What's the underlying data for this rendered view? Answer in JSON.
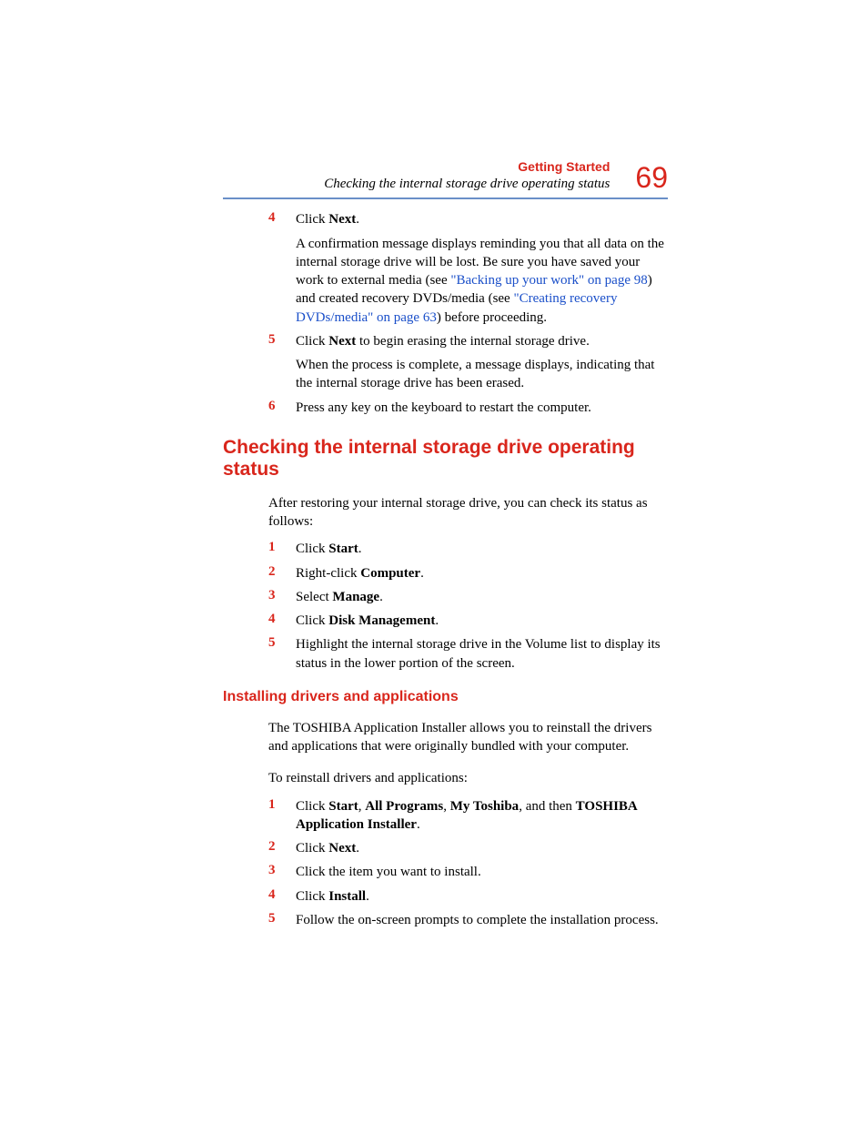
{
  "header": {
    "section_label": "Getting Started",
    "subtitle": "Checking the internal storage drive operating status",
    "page_number": "69"
  },
  "top_steps": [
    {
      "num": "4",
      "line1_pre": "Click ",
      "line1_bold": "Next",
      "line1_post": ".",
      "para_seg1": "A confirmation message displays reminding you that all data on the internal storage drive will be lost. Be sure you have saved your work to external media (see ",
      "link1": "\"Backing up your work\" on page 98",
      "para_seg2": ") and created recovery DVDs/media (see ",
      "link2": "\"Creating recovery DVDs/media\" on page 63",
      "para_seg3": ") before proceeding."
    },
    {
      "num": "5",
      "line1_pre": "Click ",
      "line1_bold": "Next",
      "line1_post": " to begin erasing the internal storage drive.",
      "para_seg1": "When the process is complete, a message displays, indicating that the internal storage drive has been erased."
    },
    {
      "num": "6",
      "line1_pre": "Press any key on the keyboard to restart the computer."
    }
  ],
  "heading1": "Checking the internal storage drive operating status",
  "para1": "After restoring your internal storage drive, you can check its status as follows:",
  "check_steps": [
    {
      "num": "1",
      "pre": "Click ",
      "bold": "Start",
      "post": "."
    },
    {
      "num": "2",
      "pre": "Right-click ",
      "bold": "Computer",
      "post": "."
    },
    {
      "num": "3",
      "pre": "Select ",
      "bold": "Manage",
      "post": "."
    },
    {
      "num": "4",
      "pre": "Click ",
      "bold": "Disk Management",
      "post": "."
    },
    {
      "num": "5",
      "pre": "Highlight the internal storage drive in the Volume list to display its status in the lower portion of the screen."
    }
  ],
  "heading2": "Installing drivers and applications",
  "para2": "The TOSHIBA Application Installer allows you to reinstall the drivers and applications that were originally bundled with your computer.",
  "para3": "To reinstall drivers and applications:",
  "install_steps": [
    {
      "num": "1",
      "segments": [
        {
          "t": "Click "
        },
        {
          "t": "Start",
          "b": true
        },
        {
          "t": ", "
        },
        {
          "t": "All Programs",
          "b": true
        },
        {
          "t": ", "
        },
        {
          "t": "My Toshiba",
          "b": true
        },
        {
          "t": ", and then "
        },
        {
          "t": "TOSHIBA Application Installer",
          "b": true
        },
        {
          "t": "."
        }
      ]
    },
    {
      "num": "2",
      "segments": [
        {
          "t": "Click "
        },
        {
          "t": "Next",
          "b": true
        },
        {
          "t": "."
        }
      ]
    },
    {
      "num": "3",
      "segments": [
        {
          "t": "Click the item you want to install."
        }
      ]
    },
    {
      "num": "4",
      "segments": [
        {
          "t": "Click "
        },
        {
          "t": "Install",
          "b": true
        },
        {
          "t": "."
        }
      ]
    },
    {
      "num": "5",
      "segments": [
        {
          "t": "Follow the on-screen prompts to complete the installation process."
        }
      ]
    }
  ]
}
